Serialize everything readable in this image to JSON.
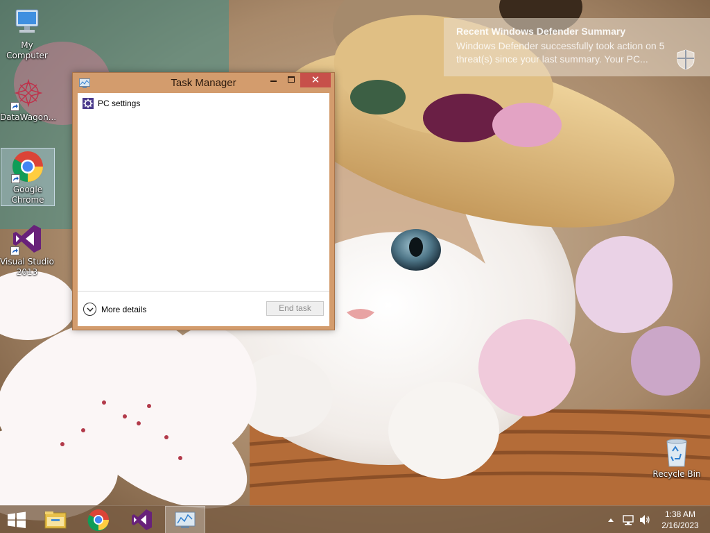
{
  "desktop": {
    "icons": [
      {
        "label": "My Computer"
      },
      {
        "label": "DataWagon..."
      },
      {
        "label": "Google\nChrome"
      },
      {
        "label": "Visual Studio\n2013"
      },
      {
        "label": "Recycle Bin"
      }
    ]
  },
  "task_manager": {
    "title": "Task Manager",
    "close_glyph": "✕",
    "processes": [
      {
        "name": "PC settings",
        "icon": "pc-settings-gear-icon"
      }
    ],
    "more_details_label": "More details",
    "end_task_label": "End task"
  },
  "notification": {
    "title": "Recent Windows Defender Summary",
    "body": "Windows Defender successfully took action on 5 threat(s) since your last summary. Your PC...",
    "icon": "defender-shield-icon"
  },
  "taskbar": {
    "pinned": [
      "file-explorer-icon",
      "chrome-icon",
      "visual-studio-icon",
      "task-manager-icon"
    ],
    "clock": {
      "time": "1:38 AM",
      "date": "2/16/2023"
    }
  },
  "colors": {
    "window_frame": "#d39c6d",
    "close_button": "#c7504a",
    "taskbar": "#785c42"
  }
}
